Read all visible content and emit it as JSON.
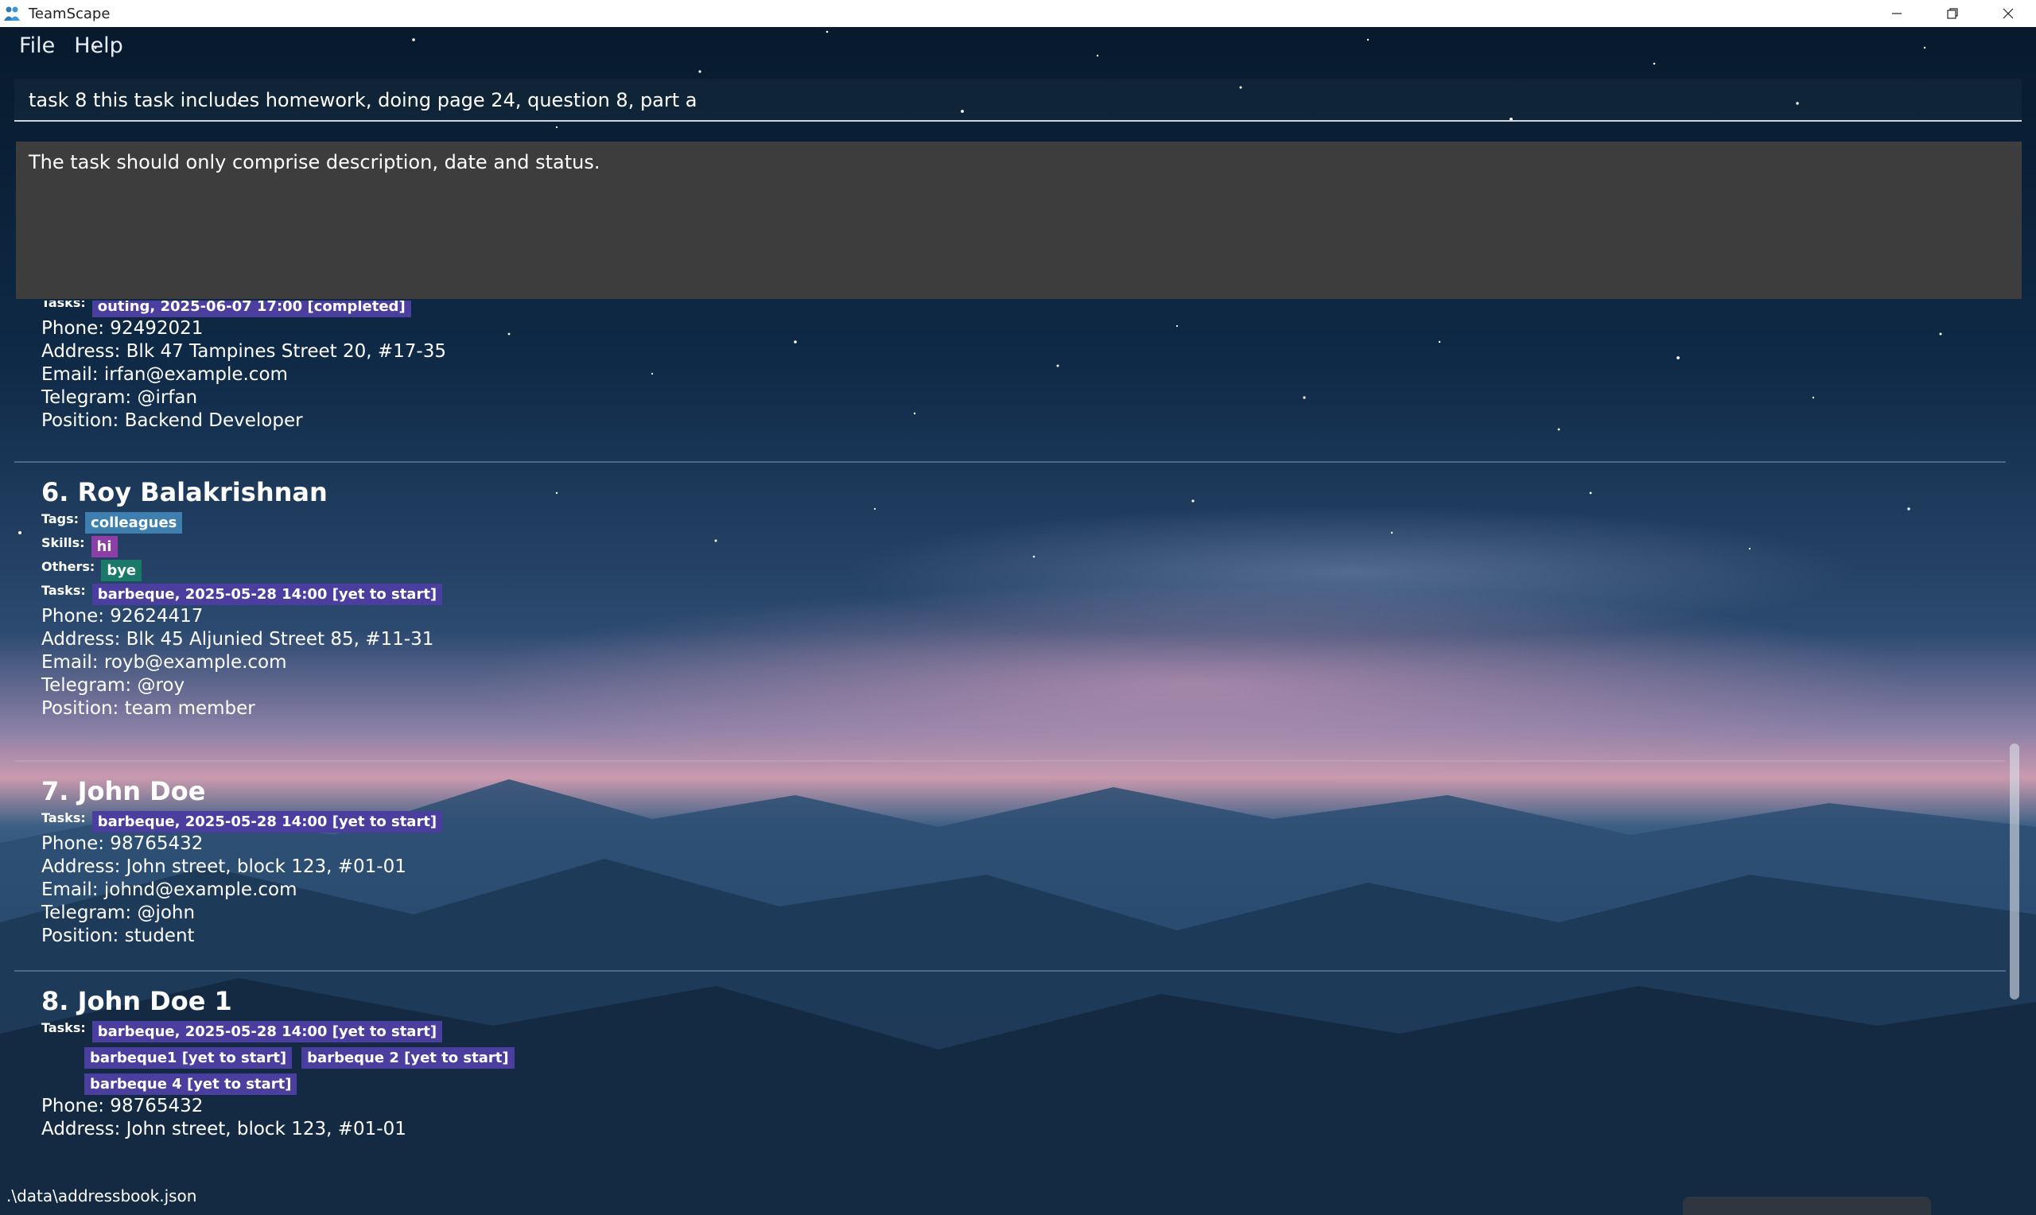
{
  "window": {
    "title": "TeamScape",
    "controls": [
      "minimize",
      "restore",
      "close"
    ]
  },
  "menu": {
    "file": "File",
    "help": "Help"
  },
  "command": {
    "value": "task 8 this task includes homework, doing page 24, question 8, part a"
  },
  "result": {
    "message": "The task should only comprise description, date and status."
  },
  "persons": [
    {
      "tasks_label": "Tasks:",
      "tasks": [
        "outing, 2025-06-07 17:00 [completed]"
      ],
      "phone": "Phone: 92492021",
      "address": "Address: Blk 47 Tampines Street 20, #17-35",
      "email": "Email: irfan@example.com",
      "telegram": "Telegram: @irfan",
      "position": "Position: Backend Developer"
    },
    {
      "name": "6. Roy Balakrishnan",
      "tags_label": "Tags:",
      "tags": [
        "colleagues"
      ],
      "skills_label": "Skills:",
      "skills": [
        "hi"
      ],
      "others_label": "Others:",
      "others": [
        "bye"
      ],
      "tasks_label": "Tasks:",
      "tasks": [
        "barbeque, 2025-05-28 14:00 [yet to start]"
      ],
      "phone": "Phone: 92624417",
      "address": "Address: Blk 45 Aljunied Street 85, #11-31",
      "email": "Email: royb@example.com",
      "telegram": "Telegram: @roy",
      "position": "Position: team member"
    },
    {
      "name": "7. John Doe",
      "tasks_label": "Tasks:",
      "tasks": [
        "barbeque, 2025-05-28 14:00 [yet to start]"
      ],
      "phone": "Phone: 98765432",
      "address": "Address: John street, block 123, #01-01",
      "email": "Email: johnd@example.com",
      "telegram": "Telegram: @john",
      "position": "Position: student"
    },
    {
      "name": "8. John Doe 1",
      "tasks_label": "Tasks:",
      "tasks": [
        "barbeque, 2025-05-28 14:00 [yet to start]",
        "barbeque1 [yet to start]",
        "barbeque 2 [yet to start]",
        "barbeque 4 [yet to start]"
      ],
      "phone": "Phone: 98765432",
      "address": "Address: John street, block 123, #01-01"
    }
  ],
  "status": {
    "file_path": ".\\data\\addressbook.json"
  },
  "colors": {
    "tag": "#3e7faf",
    "skill": "#8c3fa6",
    "other": "#1a7a6a",
    "task": "#4a3f9e",
    "result_box": "#3d3d3d"
  }
}
